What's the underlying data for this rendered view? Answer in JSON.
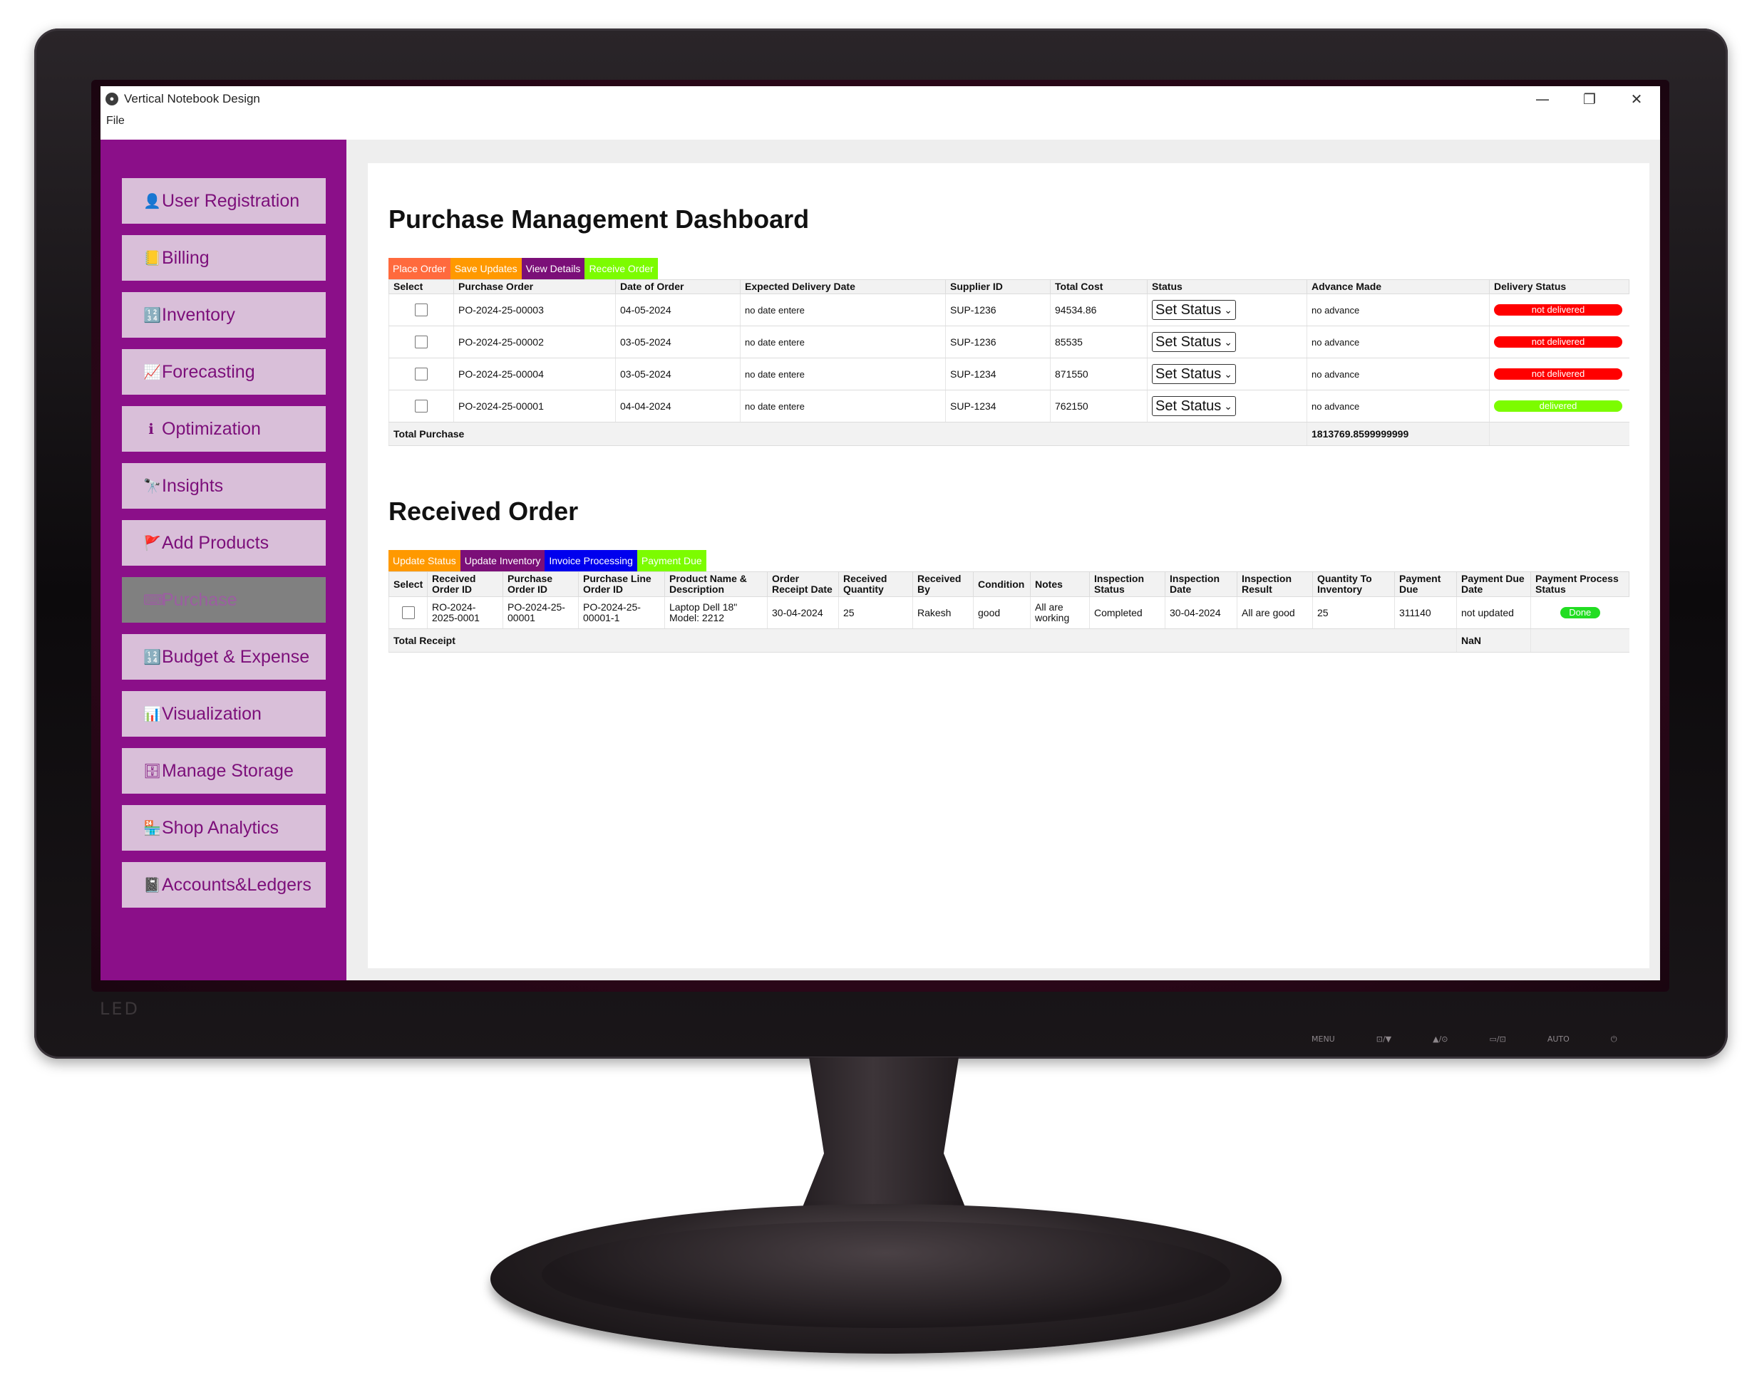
{
  "monitor": {
    "led_label": "LED",
    "controls": [
      "MENU",
      "⊡/▼",
      "▲/⊙",
      "▭/⊡",
      "AUTO",
      "⏻"
    ]
  },
  "window": {
    "title": "Vertical Notebook Design",
    "menu": [
      "File"
    ],
    "controls": {
      "minimize": "—",
      "restore": "❐",
      "close": "✕"
    }
  },
  "sidebar": {
    "items": [
      {
        "label": "User Registration",
        "icon": "user-icon",
        "glyph": "👤",
        "active": false
      },
      {
        "label": "Billing",
        "icon": "billing-icon",
        "glyph": "📒",
        "active": false
      },
      {
        "label": "Inventory",
        "icon": "inventory-icon",
        "glyph": "🔢",
        "active": false
      },
      {
        "label": "Forecasting",
        "icon": "chart-trend-icon",
        "glyph": "📈",
        "active": false
      },
      {
        "label": "Optimization",
        "icon": "info-icon",
        "glyph": "ℹ",
        "active": false
      },
      {
        "label": "Insights",
        "icon": "telescope-icon",
        "glyph": "🔭",
        "active": false
      },
      {
        "label": "Add Products",
        "icon": "flag-icon",
        "glyph": "🚩",
        "active": false
      },
      {
        "label": "Purchase",
        "icon": "keyboard-icon",
        "glyph": "⌨",
        "active": true
      },
      {
        "label": "Budget & Expense",
        "icon": "calculator-icon",
        "glyph": "🔢",
        "active": false
      },
      {
        "label": "Visualization",
        "icon": "bar-chart-icon",
        "glyph": "📊",
        "active": false
      },
      {
        "label": "Manage Storage",
        "icon": "storage-icon",
        "glyph": "🗄",
        "active": false
      },
      {
        "label": "Shop Analytics",
        "icon": "shop-icon",
        "glyph": "🏪",
        "active": false
      },
      {
        "label": "Accounts&Ledgers",
        "icon": "ledger-icon",
        "glyph": "📓",
        "active": false
      }
    ]
  },
  "purchase": {
    "title": "Purchase Management Dashboard",
    "buttons": [
      {
        "label": "Place Order",
        "color": "#ff6a3d"
      },
      {
        "label": "Save Updates",
        "color": "#ff9900"
      },
      {
        "label": "View Details",
        "color": "#7b0f78"
      },
      {
        "label": "Receive Order",
        "color": "#7cfc00"
      }
    ],
    "headers": [
      "Select",
      "Purchase Order",
      "Date of Order",
      "Expected Delivery Date",
      "Supplier ID",
      "Total Cost",
      "Status",
      "Advance Made",
      "Delivery Status"
    ],
    "rows": [
      {
        "po": "PO-2024-25-00003",
        "date": "04-05-2024",
        "expected": "no date entere",
        "supplier": "SUP-1236",
        "cost": "94534.86",
        "status": "Set Status",
        "advance": "no advance",
        "delivery": "not delivered",
        "delivered": false
      },
      {
        "po": "PO-2024-25-00002",
        "date": "03-05-2024",
        "expected": "no date entere",
        "supplier": "SUP-1236",
        "cost": "85535",
        "status": "Set Status",
        "advance": "no advance",
        "delivery": "not delivered",
        "delivered": false
      },
      {
        "po": "PO-2024-25-00004",
        "date": "03-05-2024",
        "expected": "no date entere",
        "supplier": "SUP-1234",
        "cost": "871550",
        "status": "Set Status",
        "advance": "no advance",
        "delivery": "not delivered",
        "delivered": false
      },
      {
        "po": "PO-2024-25-00001",
        "date": "04-04-2024",
        "expected": "no date entere",
        "supplier": "SUP-1234",
        "cost": "762150",
        "status": "Set Status",
        "advance": "no advance",
        "delivery": "delivered",
        "delivered": true
      }
    ],
    "total_label": "Total Purchase",
    "total_value": "1813769.8599999999"
  },
  "received": {
    "title": "Received Order",
    "buttons": [
      {
        "label": "Update Status",
        "color": "#ff9900"
      },
      {
        "label": "Update Inventory",
        "color": "#7b0f78"
      },
      {
        "label": "Invoice Processing",
        "color": "#0000ee"
      },
      {
        "label": "Payment Due",
        "color": "#7cfc00"
      }
    ],
    "headers": [
      "Select",
      "Received Order ID",
      "Purchase Order ID",
      "Purchase Line Order ID",
      "Product Name & Description",
      "Order Receipt Date",
      "Received Quantity",
      "Received By",
      "Condition",
      "Notes",
      "Inspection Status",
      "Inspection Date",
      "Inspection Result",
      "Quantity To Inventory",
      "Payment Due",
      "Payment Due Date",
      "Payment Process Status"
    ],
    "rows": [
      {
        "ro": "RO-2024-2025-0001",
        "po": "PO-2024-25-00001",
        "line": "PO-2024-25-00001-1",
        "product": "Laptop Dell 18\" Model: 2212",
        "receipt_date": "30-04-2024",
        "qty": "25",
        "by": "Rakesh",
        "condition": "good",
        "notes": "All are working",
        "insp_status": "Completed",
        "insp_date": "30-04-2024",
        "insp_result": "All are good",
        "qty_inv": "25",
        "pay_due": "311140",
        "pay_due_date": "not updated",
        "pay_status": "Done"
      }
    ],
    "total_label": "Total Receipt",
    "total_value": "NaN"
  }
}
